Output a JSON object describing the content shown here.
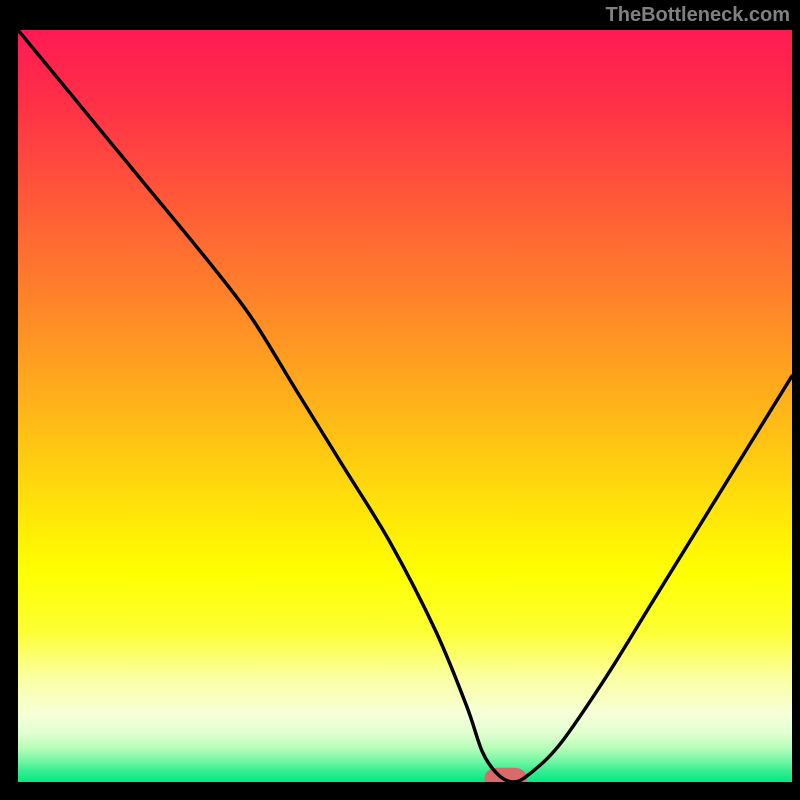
{
  "attribution": "TheBottleneck.com",
  "chart_data": {
    "type": "line",
    "title": "",
    "xlabel": "",
    "ylabel": "",
    "xlim": [
      0,
      100
    ],
    "ylim": [
      0,
      100
    ],
    "x": [
      0,
      8,
      16,
      24,
      30,
      36,
      42,
      48,
      54,
      58,
      60,
      62,
      64,
      66,
      70,
      76,
      82,
      88,
      94,
      100
    ],
    "values": [
      100,
      90,
      80,
      70,
      62,
      52,
      42,
      32,
      20,
      10,
      4,
      1,
      0,
      1,
      5,
      14,
      24,
      34,
      44,
      54
    ],
    "background_gradient": {
      "stops": [
        {
          "offset": 0.0,
          "color": "#ff1a53"
        },
        {
          "offset": 0.09,
          "color": "#ff2e48"
        },
        {
          "offset": 0.18,
          "color": "#ff4a3e"
        },
        {
          "offset": 0.27,
          "color": "#ff6733"
        },
        {
          "offset": 0.36,
          "color": "#ff8429"
        },
        {
          "offset": 0.45,
          "color": "#ffa21f"
        },
        {
          "offset": 0.54,
          "color": "#ffc114"
        },
        {
          "offset": 0.63,
          "color": "#ffe10a"
        },
        {
          "offset": 0.72,
          "color": "#ffff00"
        },
        {
          "offset": 0.8,
          "color": "#fcff33"
        },
        {
          "offset": 0.86,
          "color": "#fbffa0"
        },
        {
          "offset": 0.91,
          "color": "#f6ffd8"
        },
        {
          "offset": 0.935,
          "color": "#e1ffd0"
        },
        {
          "offset": 0.955,
          "color": "#b6fdb8"
        },
        {
          "offset": 0.972,
          "color": "#74f6a4"
        },
        {
          "offset": 0.986,
          "color": "#33ee90"
        },
        {
          "offset": 1.0,
          "color": "#06e884"
        }
      ]
    },
    "marker": {
      "x": 63,
      "y": 0.5,
      "width": 5.5,
      "height": 2.8,
      "color": "#d86a6a",
      "rx": 1.6
    }
  }
}
